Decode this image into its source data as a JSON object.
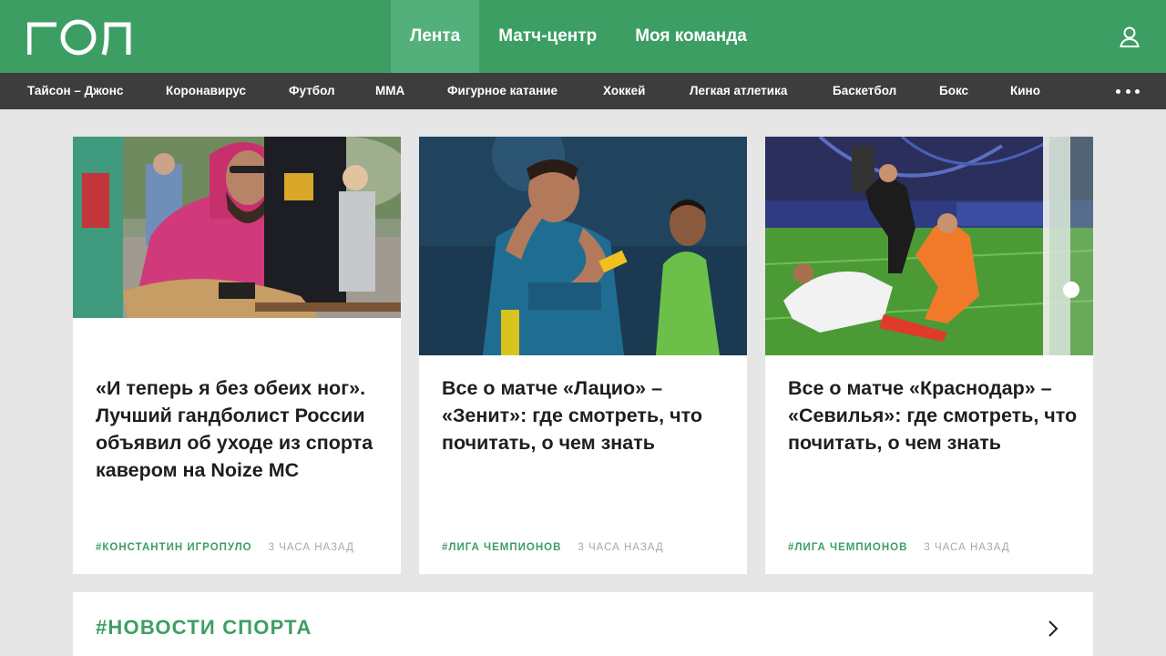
{
  "header": {
    "logo_text": "ГОЛ",
    "nav": [
      {
        "label": "Лента",
        "active": true
      },
      {
        "label": "Матч-центр",
        "active": false
      },
      {
        "label": "Моя команда",
        "active": false
      }
    ],
    "profile_icon": "user-icon"
  },
  "subnav": {
    "items": [
      "Тайсон – Джонс",
      "Коронавирус",
      "Футбол",
      "ММА",
      "Фигурное катание",
      "Хоккей",
      "Легкая атлетика",
      "Баскетбол",
      "Бокс",
      "Кино"
    ],
    "more_icon": "more-dots-icon"
  },
  "cards": [
    {
      "title": "«И теперь я без обеих ног». Лучший гандболист России объявил об уходе из спорта кавером на Noize MC",
      "tag": "#КОНСТАНТИН ИГРОПУЛО",
      "time": "3 ЧАСА НАЗАД"
    },
    {
      "title": "Все о матче «Лацио» – «Зенит»: где смотреть, что почитать, о чем знать",
      "tag": "#ЛИГА ЧЕМПИОНОВ",
      "time": "3 ЧАСА НАЗАД"
    },
    {
      "title": "Все о матче «Краснодар» – «Севилья»: где смотреть, что почитать, о чем знать",
      "tag": "#ЛИГА ЧЕМПИОНОВ",
      "time": "3 ЧАСА НАЗАД"
    }
  ],
  "news_section": {
    "title": "#НОВОСТИ СПОРТА",
    "arrow_icon": "chevron-right-icon"
  },
  "colors": {
    "brand_green": "#3d9e64",
    "active_tab": "#54b07a",
    "subnav_bg": "#3d3d3d",
    "page_bg": "#e6e6e6"
  }
}
